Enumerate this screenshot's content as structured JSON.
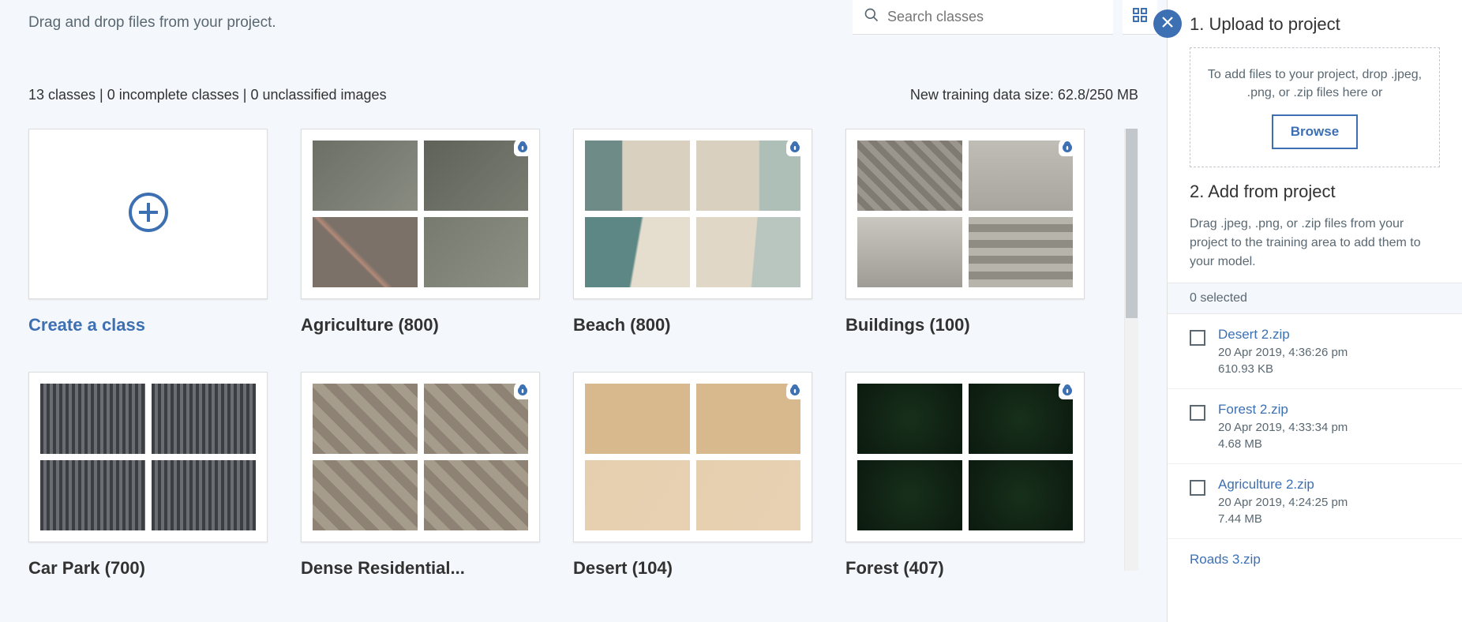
{
  "main": {
    "hint": "Drag and drop files from your project.",
    "search_placeholder": "Search classes",
    "stats_left": "13 classes | 0 incomplete classes | 0 unclassified images",
    "stats_right": "New training data size: 62.8/250 MB",
    "create_label": "Create a class",
    "classes": [
      {
        "name": "Agriculture",
        "count": 800,
        "negative": true,
        "thumbs": [
          "t-agri1",
          "t-agri2",
          "t-agri3",
          "t-agri4"
        ]
      },
      {
        "name": "Beach",
        "count": 800,
        "negative": true,
        "thumbs": [
          "t-beach1",
          "t-beach2",
          "t-beach3",
          "t-beach4"
        ]
      },
      {
        "name": "Buildings",
        "count": 100,
        "negative": true,
        "thumbs": [
          "t-build1",
          "t-build2",
          "t-build3",
          "t-build4"
        ]
      },
      {
        "name": "Car Park",
        "count": 700,
        "negative": false,
        "thumbs": [
          "t-car1",
          "t-car2",
          "t-car3",
          "t-car4"
        ]
      },
      {
        "name": "Dense Residential",
        "count": null,
        "display": "Dense Residential...",
        "negative": true,
        "thumbs": [
          "t-dense1",
          "t-dense2",
          "t-dense3",
          "t-dense4"
        ]
      },
      {
        "name": "Desert",
        "count": 104,
        "negative": true,
        "thumbs": [
          "t-desert1",
          "t-desert2",
          "t-desert3",
          "t-desert4"
        ]
      },
      {
        "name": "Forest",
        "count": 407,
        "negative": true,
        "thumbs": [
          "t-forest1",
          "t-forest2",
          "t-forest3",
          "t-forest4"
        ]
      }
    ]
  },
  "panel": {
    "section1_title": "1. Upload to project",
    "dropzone_text": "To add files to your project, drop .jpeg, .png, or .zip files here or",
    "browse_label": "Browse",
    "section2_title": "2. Add from project",
    "section2_desc": "Drag .jpeg, .png, or .zip files from your project to the training area to add them to your model.",
    "selected_text": "0 selected",
    "files": [
      {
        "name": "Desert 2.zip",
        "date": "20 Apr 2019, 4:36:26 pm",
        "size": "610.93 KB"
      },
      {
        "name": "Forest 2.zip",
        "date": "20 Apr 2019, 4:33:34 pm",
        "size": "4.68 MB"
      },
      {
        "name": "Agriculture 2.zip",
        "date": "20 Apr 2019, 4:24:25 pm",
        "size": "7.44 MB"
      },
      {
        "name": "Roads 3.zip",
        "date": "",
        "size": "",
        "partial": true
      }
    ]
  }
}
